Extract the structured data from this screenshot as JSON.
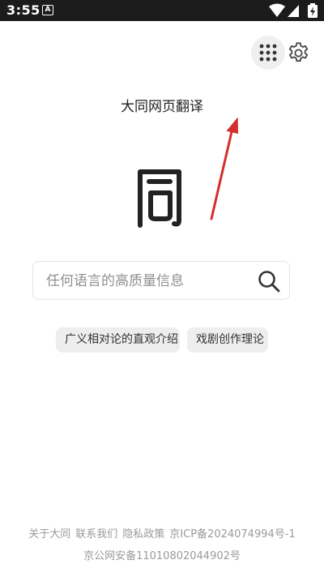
{
  "status_bar": {
    "time": "3:55",
    "notification_icon": "A-icon"
  },
  "header": {
    "apps_icon": "grid-dots-icon",
    "settings_icon": "gear-icon"
  },
  "app": {
    "title": "大同网页翻译",
    "logo_icon": "tong-seal-logo"
  },
  "search": {
    "placeholder": "任何语言的高质量信息",
    "value": "",
    "icon": "search-icon"
  },
  "suggestions": [
    "广义相对论的直观介绍",
    "戏剧创作理论"
  ],
  "footer": {
    "links": [
      "关于大同",
      "联系我们",
      "隐私政策",
      "京ICP备2024074994号-1"
    ],
    "police_record": "京公网安备11010802044902号"
  },
  "colors": {
    "annotation_arrow": "#d32f2f",
    "chip_bg": "#eeeeee",
    "status_bar_bg": "#1b1b1b"
  }
}
